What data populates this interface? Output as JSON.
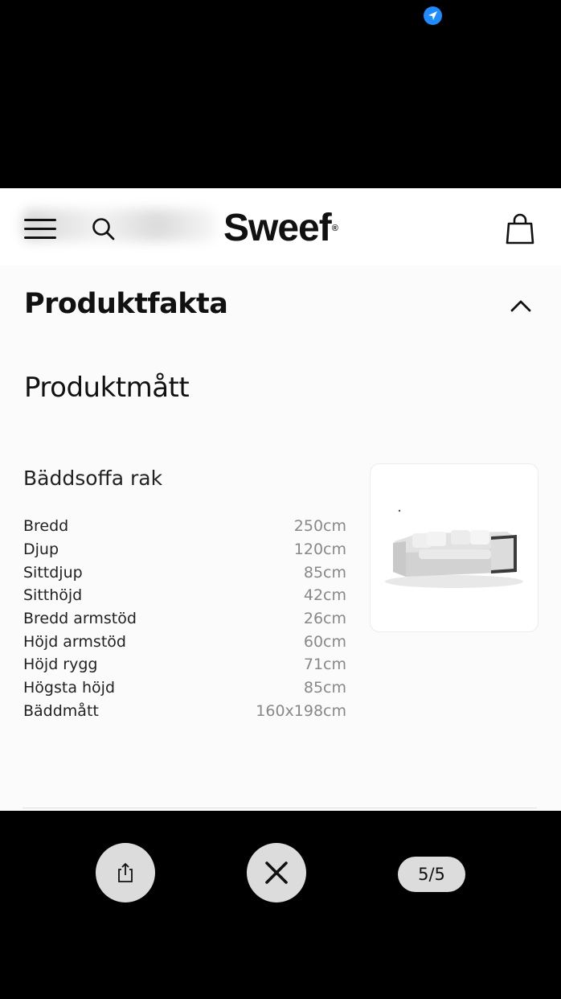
{
  "status_bar": {
    "location_icon": "location-arrow-icon"
  },
  "header": {
    "brand": "Sweef",
    "brand_mark": "®",
    "icons": [
      "menu-icon",
      "search-icon",
      "shopping-bag-icon"
    ]
  },
  "section": {
    "title": "Produktfakta",
    "expanded": true
  },
  "subsection": {
    "title": "Produktmått"
  },
  "product": {
    "name": "Bäddsoffa rak",
    "dimensions": [
      {
        "label": "Bredd",
        "value": "250cm"
      },
      {
        "label": "Djup",
        "value": "120cm"
      },
      {
        "label": "Sittdjup",
        "value": "85cm"
      },
      {
        "label": "Sitthöjd",
        "value": "42cm"
      },
      {
        "label": "Bredd armstöd",
        "value": "26cm"
      },
      {
        "label": "Höjd armstöd",
        "value": "60cm"
      },
      {
        "label": "Höjd rygg",
        "value": "71cm"
      },
      {
        "label": "Högsta höjd",
        "value": "85cm"
      },
      {
        "label": "Bäddmått",
        "value": "160x198cm"
      }
    ]
  },
  "viewer": {
    "counter": "5/5",
    "buttons": [
      "share-icon",
      "close-icon"
    ]
  }
}
